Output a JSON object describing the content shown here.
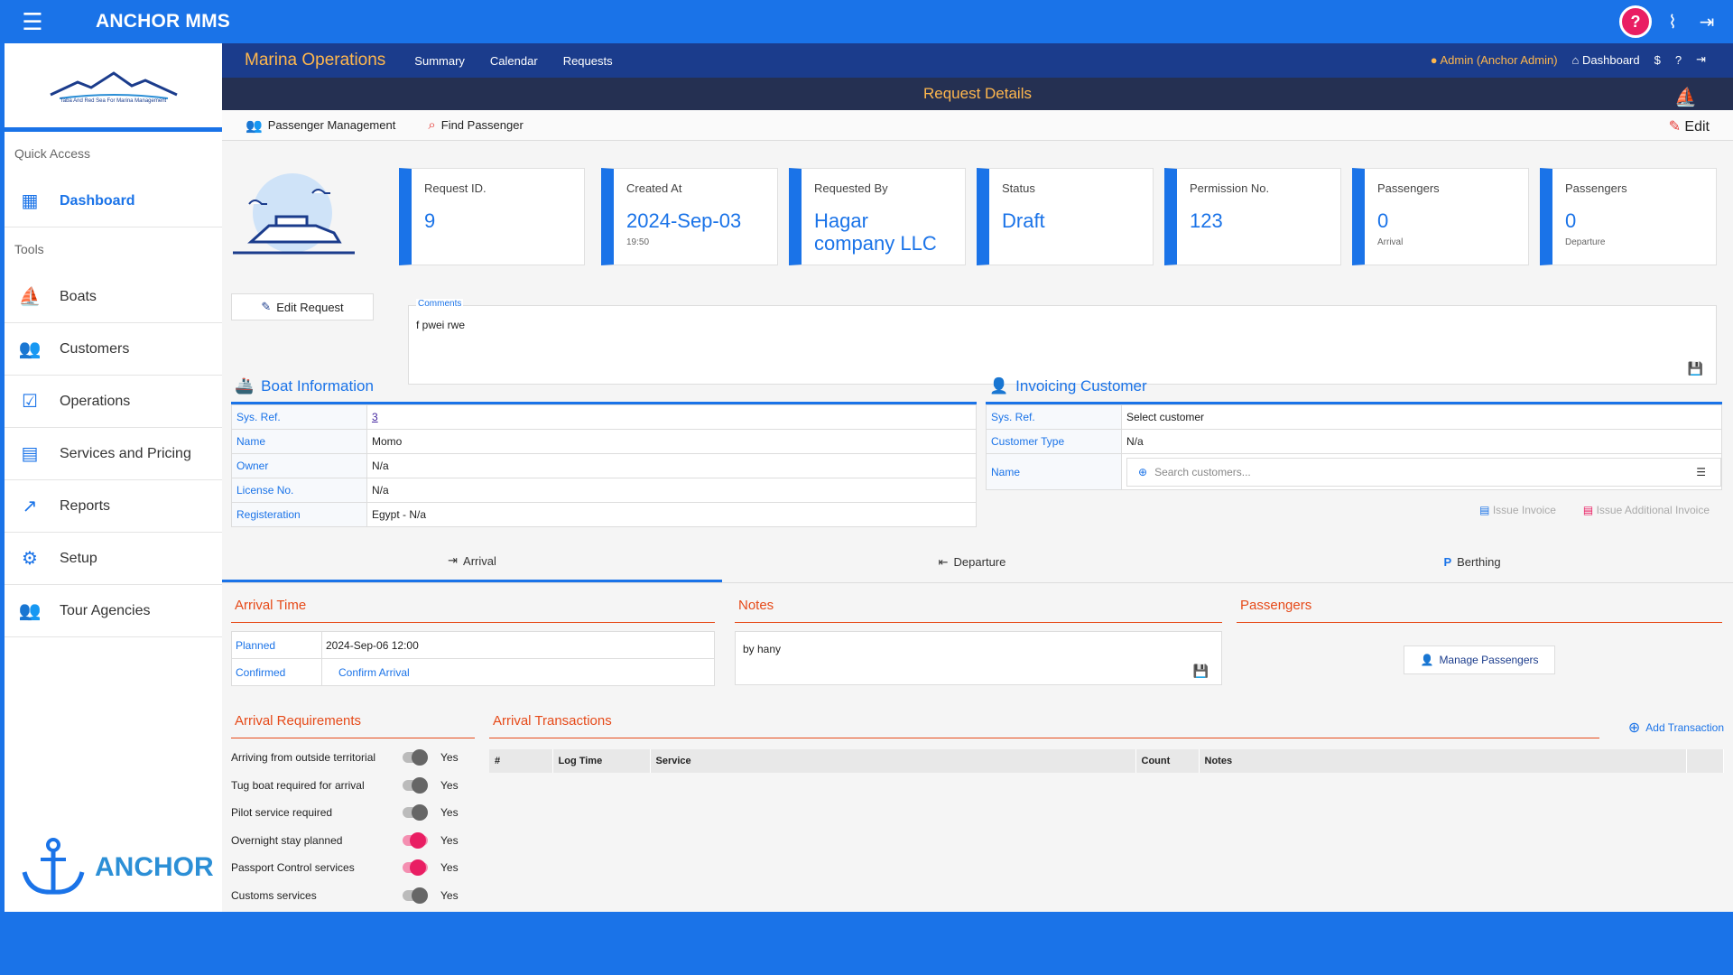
{
  "app": {
    "brand": "ANCHOR MMS"
  },
  "sidebar": {
    "logo_tagline": "Taba And Red Sea For Marina Management",
    "quick_access_label": "Quick Access",
    "tools_label": "Tools",
    "items": [
      {
        "label": "Dashboard",
        "icon": "dashboard-icon"
      },
      {
        "label": "Boats",
        "icon": "sailboat-icon"
      },
      {
        "label": "Customers",
        "icon": "people-icon"
      },
      {
        "label": "Operations",
        "icon": "checklist-icon"
      },
      {
        "label": "Services and Pricing",
        "icon": "store-icon"
      },
      {
        "label": "Reports",
        "icon": "trend-icon"
      },
      {
        "label": "Setup",
        "icon": "gear-icon"
      },
      {
        "label": "Tour Agencies",
        "icon": "people-icon"
      }
    ],
    "footer_logo_text": "ANCHOR"
  },
  "subnav": {
    "title": "Marina Operations",
    "links": [
      "Summary",
      "Calendar",
      "Requests"
    ],
    "admin": "Admin (Anchor Admin)",
    "dashboard": "Dashboard"
  },
  "page_title": "Request Details",
  "toolbar": {
    "passenger_management": "Passenger Management",
    "find_passenger": "Find Passenger",
    "edit": "Edit"
  },
  "cards": [
    {
      "label": "Request ID.",
      "value": "9",
      "sub": ""
    },
    {
      "label": "Created At",
      "value": "2024-Sep-03",
      "sub": "19:50"
    },
    {
      "label": "Requested By",
      "value": "Hagar company LLC",
      "sub": ""
    },
    {
      "label": "Status",
      "value": "Draft",
      "sub": ""
    },
    {
      "label": "Permission No.",
      "value": "123",
      "sub": ""
    },
    {
      "label": "Passengers",
      "value": "0",
      "sub": "Arrival"
    },
    {
      "label": "Passengers",
      "value": "0",
      "sub": "Departure"
    }
  ],
  "edit_request": "Edit Request",
  "comments": {
    "label": "Comments",
    "text": "f pwei rwe"
  },
  "boat_info": {
    "title": "Boat Information",
    "rows": [
      {
        "k": "Sys. Ref.",
        "v": "3"
      },
      {
        "k": "Name",
        "v": "Momo"
      },
      {
        "k": "Owner",
        "v": "N/a"
      },
      {
        "k": "License No.",
        "v": "N/a"
      },
      {
        "k": "Registeration",
        "v": "Egypt - N/a"
      }
    ]
  },
  "invoicing": {
    "title": "Invoicing Customer",
    "sys_ref_label": "Sys. Ref.",
    "sys_ref_value": "Select customer",
    "customer_type_label": "Customer Type",
    "customer_type_value": "N/a",
    "name_label": "Name",
    "search_placeholder": "Search customers...",
    "issue_invoice": "Issue Invoice",
    "issue_additional": "Issue Additional Invoice"
  },
  "tabs": [
    "Arrival",
    "Departure",
    "Berthing"
  ],
  "arrival_time": {
    "title": "Arrival Time",
    "planned_label": "Planned",
    "planned_value": "2024-Sep-06 12:00",
    "confirmed_label": "Confirmed",
    "confirmed_action": "Confirm Arrival"
  },
  "notes": {
    "title": "Notes",
    "text": "by hany"
  },
  "passengers": {
    "title": "Passengers",
    "manage": "Manage Passengers"
  },
  "requirements": {
    "title": "Arrival Requirements",
    "items": [
      {
        "label": "Arriving from outside territorial",
        "value": "Yes",
        "on": false
      },
      {
        "label": "Tug boat required for arrival",
        "value": "Yes",
        "on": false
      },
      {
        "label": "Pilot service required",
        "value": "Yes",
        "on": false
      },
      {
        "label": "Overnight stay planned",
        "value": "Yes",
        "on": true
      },
      {
        "label": "Passport Control services",
        "value": "Yes",
        "on": true
      },
      {
        "label": "Customs services",
        "value": "Yes",
        "on": false
      }
    ]
  },
  "transactions": {
    "title": "Arrival Transactions",
    "add": "Add Transaction",
    "columns": [
      "#",
      "Log Time",
      "Service",
      "Count",
      "Notes"
    ]
  },
  "colors": {
    "primary": "#1a73e8",
    "navy": "#1b3c8c",
    "accent_orange": "#e64a19",
    "toggle_on": "#e91e63"
  }
}
